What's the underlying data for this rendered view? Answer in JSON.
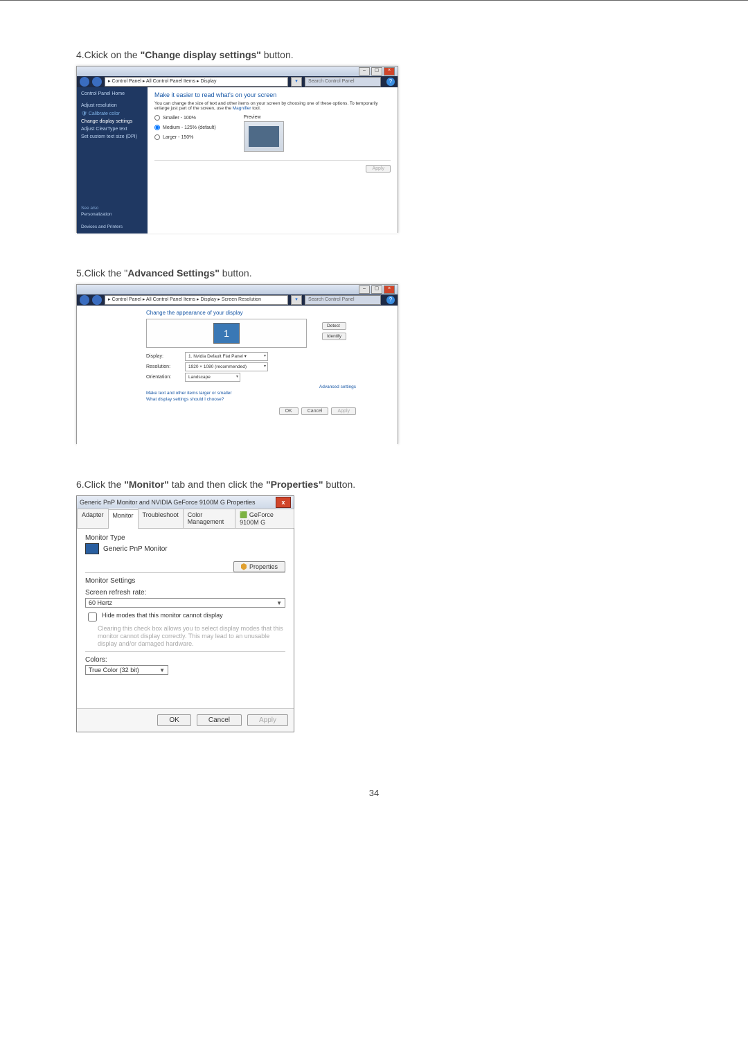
{
  "page_number": "34",
  "step4": {
    "text_prefix": "4.Ckick on the ",
    "text_bold": "\"Change display settings\"",
    "text_suffix": " button.",
    "breadcrumb": "▸ Control Panel ▸ All Control Panel Items ▸ Display",
    "search_placeholder": "Search Control Panel",
    "search_prefix": "▾",
    "side": {
      "home": "Control Panel Home",
      "adjust_res": "Adjust resolution",
      "calibrate": "Calibrate color",
      "change_disp": "Change display settings",
      "cleartype": "Adjust ClearType text",
      "dpi": "Set custom text size (DPI)",
      "see_also": "See also",
      "personalization": "Personalization",
      "devices": "Devices and Printers"
    },
    "main": {
      "heading": "Make it easier to read what's on your screen",
      "desc1": "You can change the size of text and other items on your screen by choosing one of these options. To temporarily enlarge just part of the screen, use the ",
      "desc_link": "Magnifier",
      "desc2": " tool.",
      "r1": "Smaller - 100%",
      "r2": "Medium - 125% (default)",
      "r3": "Larger - 150%",
      "preview": "Preview",
      "apply": "Apply"
    }
  },
  "step5": {
    "text_prefix": "5.Click the \"",
    "text_bold": "Advanced Settings\"",
    "text_suffix": " button.",
    "breadcrumb": "▸ Control Panel ▸ All Control Panel Items ▸ Display ▸ Screen Resolution",
    "search_placeholder": "Search Control Panel",
    "heading": "Change the appearance of your display",
    "monitor_num": "1",
    "detect": "Detect",
    "identify": "Identify",
    "display_lbl": "Display:",
    "display_val": "1. Nvidia Default Flat Panel ▾",
    "res_lbl": "Resolution:",
    "res_val": "1920 × 1080 (recommended)",
    "orient_lbl": "Orientation:",
    "orient_val": "Landscape",
    "advanced": "Advanced settings",
    "link1": "Make text and other items larger or smaller",
    "link2": "What display settings should I choose?",
    "ok": "OK",
    "cancel": "Cancel",
    "apply": "Apply"
  },
  "step6": {
    "text_prefix": "6.Click the ",
    "text_bold1": "\"Monitor\"",
    "text_mid": " tab and then click the ",
    "text_bold2": "\"Properties\"",
    "text_suffix": " button.",
    "title": "Generic PnP Monitor and NVIDIA GeForce 9100M G   Properties",
    "tabs": {
      "adapter": "Adapter",
      "monitor": "Monitor",
      "troubleshoot": "Troubleshoot",
      "color": "Color Management",
      "geforce": "GeForce 9100M G"
    },
    "monitor_type": "Monitor Type",
    "monitor_name": "Generic PnP Monitor",
    "properties": "Properties",
    "settings": "Monitor Settings",
    "refresh_lbl": "Screen refresh rate:",
    "refresh_val": "60 Hertz",
    "hide_modes": "Hide modes that this monitor cannot display",
    "hide_note": "Clearing this check box allows you to select display modes that this monitor cannot display correctly. This may lead to an unusable display and/or damaged hardware.",
    "colors_lbl": "Colors:",
    "colors_val": "True Color (32 bit)",
    "ok": "OK",
    "cancel": "Cancel",
    "apply": "Apply"
  }
}
